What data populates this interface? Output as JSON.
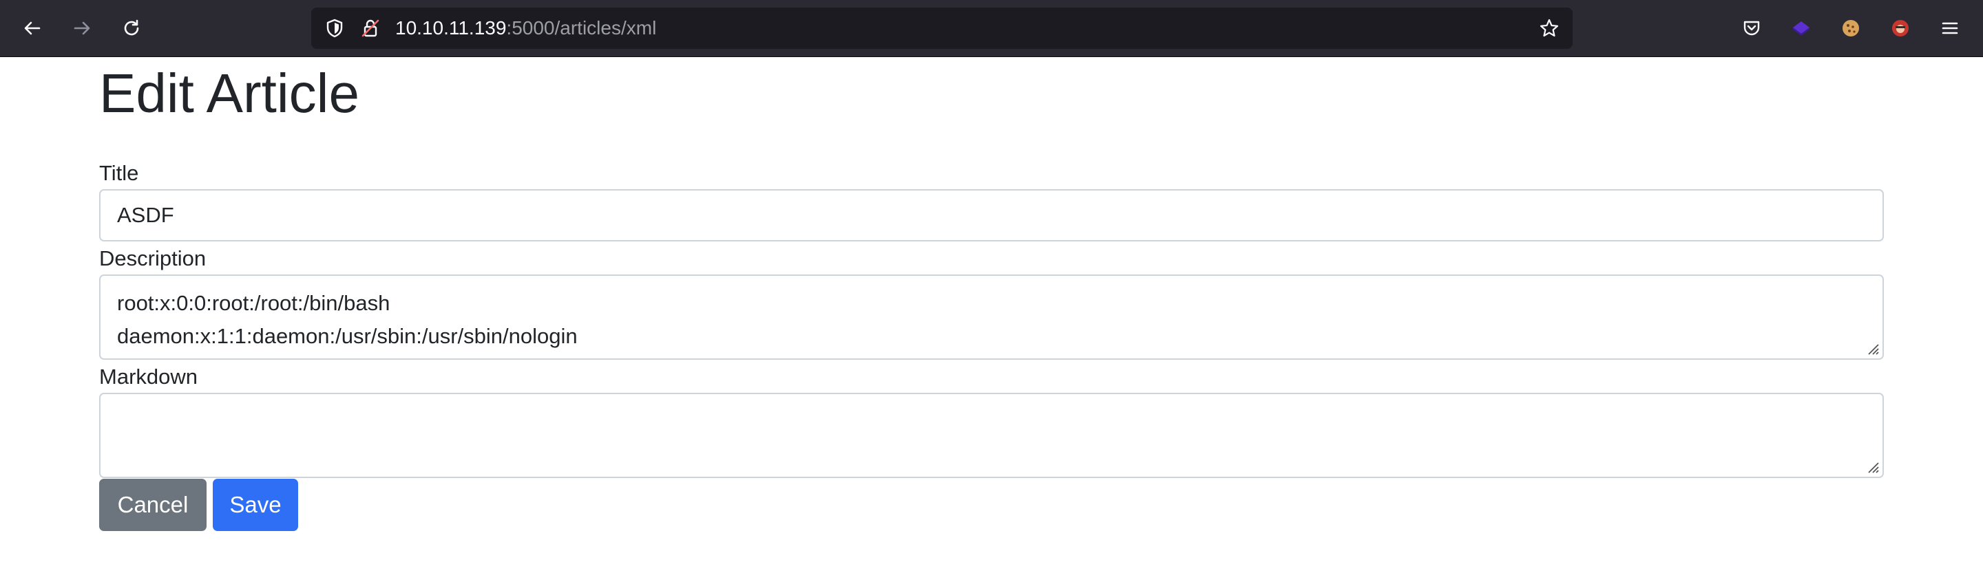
{
  "browser": {
    "url_host": "10.10.11.139",
    "url_rest": ":5000/articles/xml",
    "icons": {
      "back": "back-arrow-icon",
      "forward": "forward-arrow-icon",
      "reload": "reload-icon",
      "shield": "tracking-protection-shield-icon",
      "insecure": "insecure-connection-icon",
      "bookmark": "bookmark-star-icon",
      "pocket": "pocket-icon",
      "extension1": "purple-extension-icon",
      "extension2": "cookie-extension-icon",
      "extension3": "red-extension-icon",
      "menu": "hamburger-menu-icon"
    }
  },
  "page": {
    "title": "Edit Article",
    "form": {
      "title_label": "Title",
      "title_value": "ASDF",
      "description_label": "Description",
      "description_lines": [
        "root:x:0:0:root:/root:/bin/bash",
        "daemon:x:1:1:daemon:/usr/sbin:/usr/sbin/nologin"
      ],
      "markdown_label": "Markdown",
      "markdown_value": "",
      "cancel_label": "Cancel",
      "save_label": "Save"
    }
  },
  "colors": {
    "toolbar_bg": "#2b2a33",
    "urlbar_bg": "#1c1b22",
    "cancel_bg": "#6c757d",
    "save_bg": "#2f6ff5",
    "text": "#212529",
    "border": "#ced4da"
  }
}
